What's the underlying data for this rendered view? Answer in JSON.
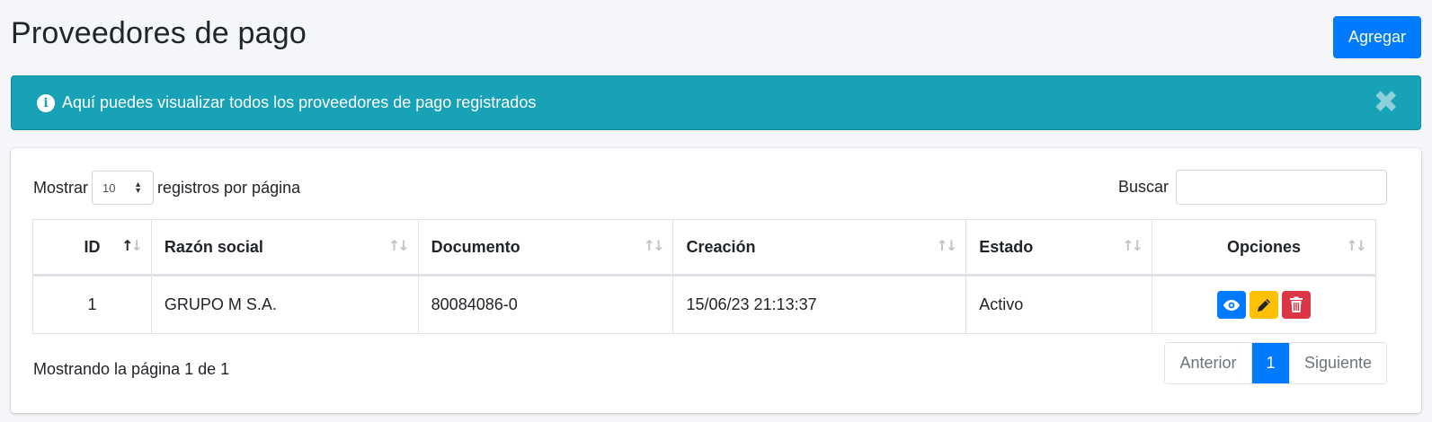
{
  "page": {
    "title": "Proveedores de pago",
    "add_label": "Agregar"
  },
  "alert": {
    "message": "Aquí puedes visualizar todos los proveedores de pago registrados",
    "close_symbol": "✖"
  },
  "length": {
    "prefix": "Mostrar",
    "value": "10",
    "suffix": "registros por página"
  },
  "search": {
    "label": "Buscar",
    "value": ""
  },
  "table": {
    "headers": [
      "ID",
      "Razón social",
      "Documento",
      "Creación",
      "Estado",
      "Opciones"
    ],
    "rows": [
      {
        "id": "1",
        "razon_social": "GRUPO M S.A.",
        "documento": "80084086-0",
        "creacion": "15/06/23 21:13:37",
        "estado": "Activo"
      }
    ]
  },
  "footer": {
    "info": "Mostrando la página 1 de 1"
  },
  "pagination": {
    "prev": "Anterior",
    "current": "1",
    "next": "Siguiente"
  },
  "colors": {
    "primary": "#007bff",
    "info": "#17a2b8",
    "warning": "#ffc107",
    "danger": "#dc3545"
  },
  "icons": {
    "alert": "info-circle-icon",
    "view": "eye-icon",
    "edit": "pencil-icon",
    "delete": "trash-icon"
  }
}
